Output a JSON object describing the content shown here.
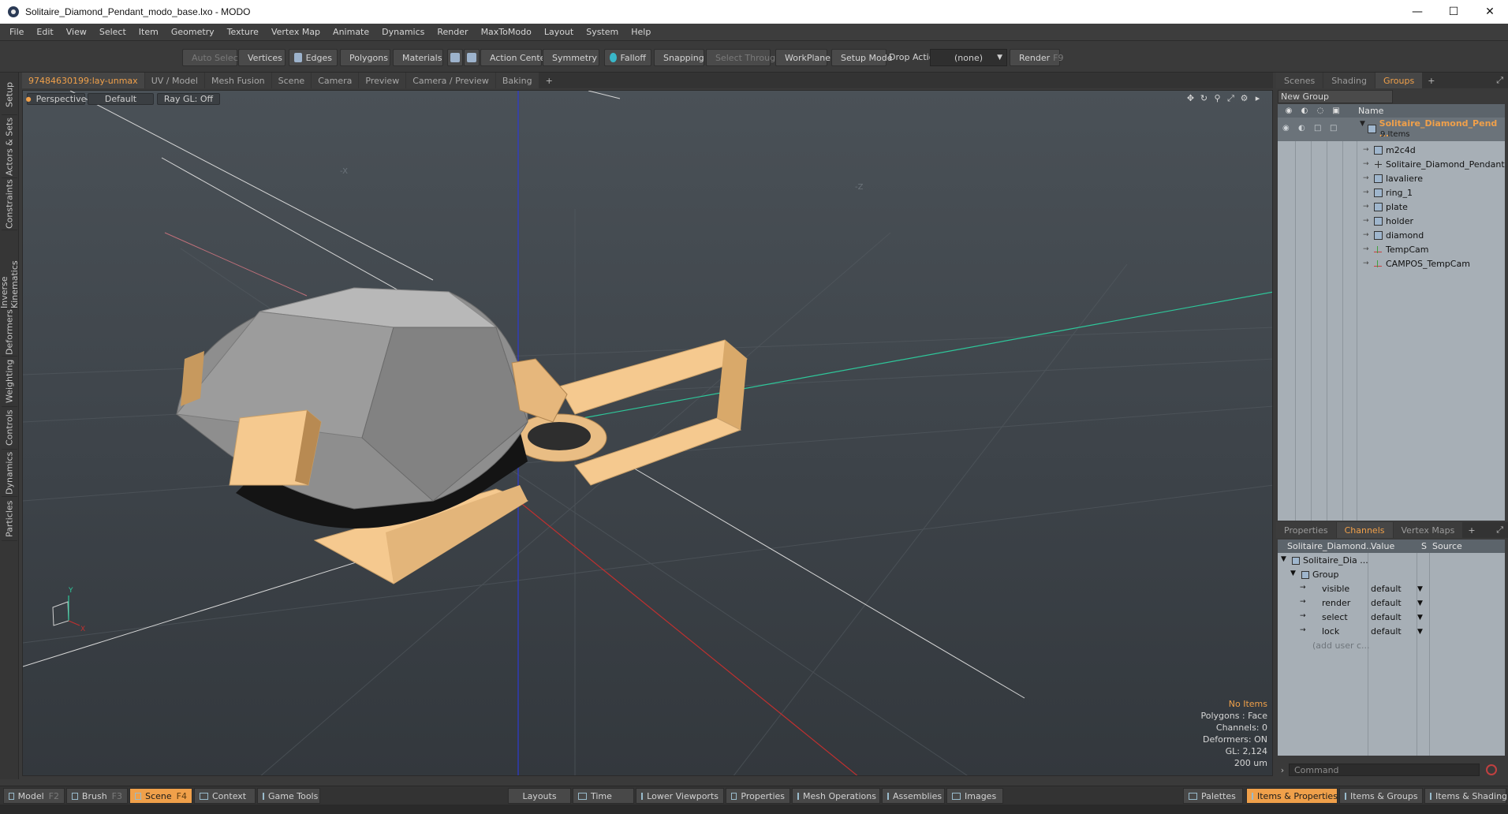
{
  "window": {
    "title": "Solitaire_Diamond_Pendant_modo_base.lxo - MODO",
    "minimize": "—",
    "maximize": "☐",
    "close": "✕"
  },
  "menu": [
    "File",
    "Edit",
    "View",
    "Select",
    "Item",
    "Geometry",
    "Texture",
    "Vertex Map",
    "Animate",
    "Dynamics",
    "Render",
    "MaxToModo",
    "Layout",
    "System",
    "Help"
  ],
  "toolbar": {
    "auto_select": "Auto Select",
    "vertices": "Vertices",
    "edges": "Edges",
    "polygons": "Polygons",
    "materials": "Materials",
    "action_center": "Action Center",
    "symmetry": "Symmetry",
    "falloff": "Falloff",
    "snapping": "Snapping",
    "select_through": "Select Through",
    "workplane": "WorkPlane",
    "setup_mode": "Setup Mode",
    "drop_action_label": "Drop Action",
    "drop_action_value": "(none)",
    "render": "Render",
    "render_key": "F9"
  },
  "left_tabs": [
    "Setup",
    "Actors & Sets",
    "Constraints",
    "Inverse Kinematics",
    "Deformers",
    "Weighting",
    "Controls",
    "Dynamics",
    "Particles"
  ],
  "viewport_tabs": [
    {
      "label": "97484630199:lay-unmax",
      "active": true
    },
    {
      "label": "UV / Model",
      "active": false
    },
    {
      "label": "Mesh Fusion",
      "active": false
    },
    {
      "label": "Scene",
      "active": false
    },
    {
      "label": "Camera",
      "active": false
    },
    {
      "label": "Preview",
      "active": false
    },
    {
      "label": "Camera / Preview",
      "active": false
    },
    {
      "label": "Baking",
      "active": false
    }
  ],
  "viewport": {
    "view_mode": "Perspective",
    "shading": "Default",
    "raygl": "Ray GL: Off",
    "axis_x_label": "-X",
    "axis_z_label": "-Z",
    "gizmo_x": "X",
    "gizmo_y": "Y",
    "info": {
      "selection": "No Items",
      "polygons": "Polygons : Face",
      "channels": "Channels: 0",
      "deformers": "Deformers: ON",
      "gl": "GL: 2,124",
      "scale": "200 um"
    },
    "colors": {
      "gold": "#f5c98f",
      "stone": "#a9a9a9",
      "axis_x": "#c0302f",
      "axis_y": "#2ec79a",
      "axis_z": "#2d3ad1"
    }
  },
  "right_tabs_top": [
    {
      "label": "Scenes",
      "active": false
    },
    {
      "label": "Shading",
      "active": false
    },
    {
      "label": "Groups",
      "active": true
    }
  ],
  "groups": {
    "new_group": "New Group",
    "name_header": "Name",
    "root_name": "Solitaire_Diamond_Pend ...",
    "root_count": "9 Items",
    "items": [
      {
        "name": "m2c4d",
        "icon": "group"
      },
      {
        "name": "Solitaire_Diamond_Pendant",
        "icon": "locator"
      },
      {
        "name": "lavaliere",
        "icon": "mesh"
      },
      {
        "name": "ring_1",
        "icon": "mesh"
      },
      {
        "name": "plate",
        "icon": "mesh"
      },
      {
        "name": "holder",
        "icon": "mesh"
      },
      {
        "name": "diamond",
        "icon": "mesh"
      },
      {
        "name": "TempCam",
        "icon": "camera"
      },
      {
        "name": "CAMPOS_TempCam",
        "icon": "camera"
      }
    ]
  },
  "right_tabs_bottom": [
    {
      "label": "Properties",
      "active": false
    },
    {
      "label": "Channels",
      "active": true
    },
    {
      "label": "Vertex Maps",
      "active": false
    }
  ],
  "channels": {
    "col_item": "Solitaire_Diamond...",
    "col_value": "Value",
    "col_s": "S",
    "col_source": "Source",
    "root": "Solitaire_Dia ...",
    "group": "Group",
    "rows": [
      {
        "name": "visible",
        "value": "default"
      },
      {
        "name": "render",
        "value": "default"
      },
      {
        "name": "select",
        "value": "default"
      },
      {
        "name": "lock",
        "value": "default"
      }
    ],
    "add_user": "(add user c..."
  },
  "command": {
    "placeholder": "Command"
  },
  "bottom": {
    "model": "Model",
    "model_key": "F2",
    "brush": "Brush",
    "brush_key": "F3",
    "scene": "Scene",
    "scene_key": "F4",
    "context": "Context",
    "game_tools": "Game Tools",
    "layouts": "Layouts",
    "time": "Time",
    "lower_viewports": "Lower Viewports",
    "properties": "Properties",
    "mesh_operations": "Mesh Operations",
    "assemblies": "Assemblies",
    "images": "Images",
    "palettes": "Palettes",
    "items_properties": "Items & Properties",
    "items_groups": "Items & Groups",
    "items_shading": "Items & Shading"
  }
}
